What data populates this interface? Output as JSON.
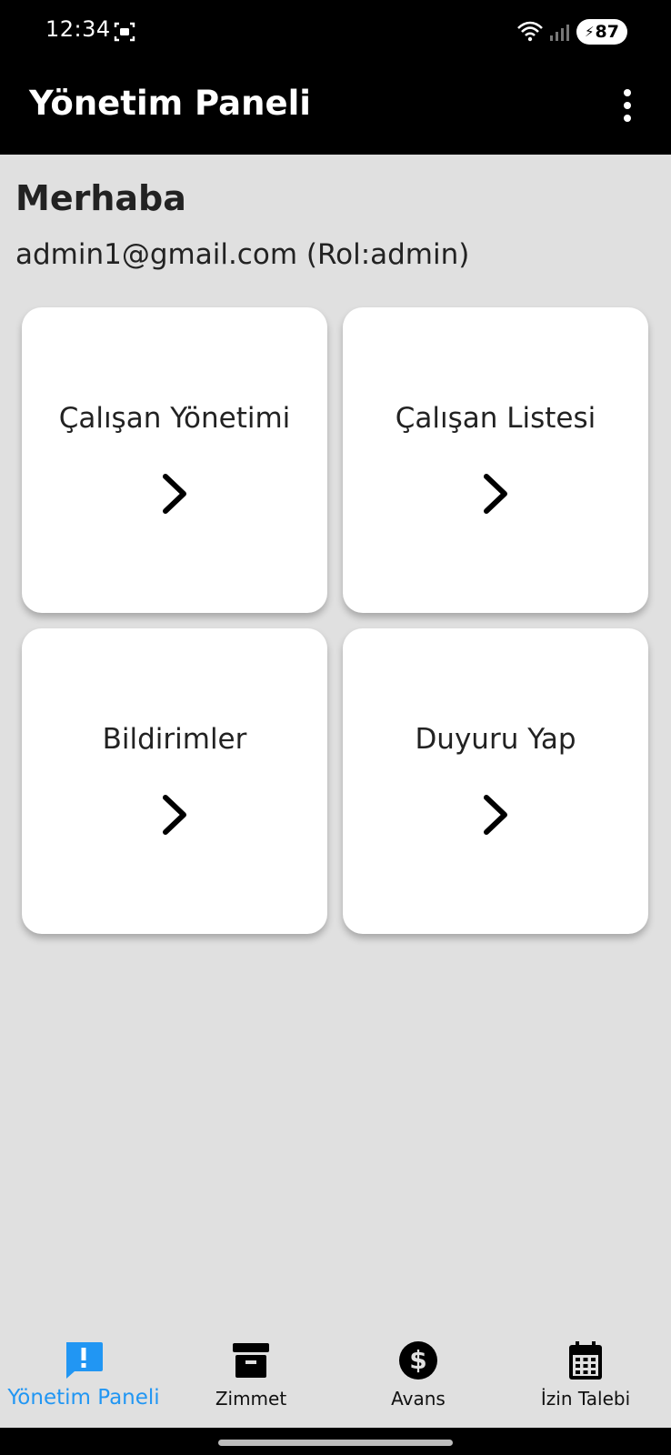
{
  "status_bar": {
    "time": "12:34",
    "battery": "87",
    "icons": [
      "screenshot-icon",
      "wifi-icon",
      "signal-icon",
      "battery-charging-icon"
    ]
  },
  "app_bar": {
    "title": "Yönetim Paneli",
    "menu_icon": "more-vertical-icon"
  },
  "greeting": {
    "title": "Merhaba",
    "user": "admin1@gmail.com (Rol:admin)"
  },
  "cards": [
    {
      "label": "Çalışan Yönetimi",
      "icon": "chevron-right-icon"
    },
    {
      "label": "Çalışan Listesi",
      "icon": "chevron-right-icon"
    },
    {
      "label": "Bildirimler",
      "icon": "chevron-right-icon"
    },
    {
      "label": "Duyuru Yap",
      "icon": "chevron-right-icon"
    }
  ],
  "bottom_nav": [
    {
      "label": "Yönetim Paneli",
      "icon": "alert-message-icon",
      "active": true
    },
    {
      "label": "Zimmet",
      "icon": "archive-box-icon",
      "active": false
    },
    {
      "label": "Avans",
      "icon": "dollar-icon",
      "active": false
    },
    {
      "label": "İzin Talebi",
      "icon": "calendar-icon",
      "active": false
    }
  ],
  "colors": {
    "accent": "#2196f3",
    "app_bar": "#000000",
    "background": "#e0e0e0",
    "card": "#ffffff"
  }
}
